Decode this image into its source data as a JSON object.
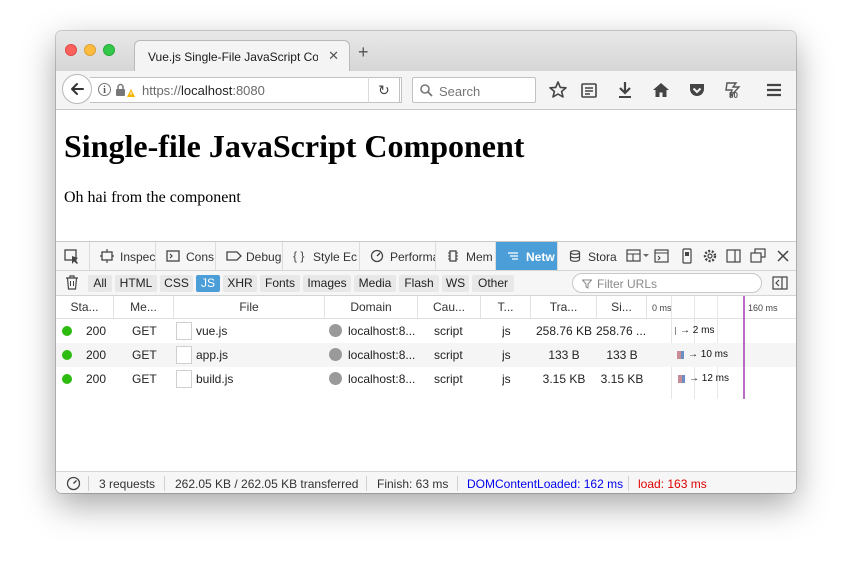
{
  "browser": {
    "tab_title": "Vue.js Single-File JavaScript Com",
    "url_scheme": "https://",
    "url_host": "localhost",
    "url_port": ":8080",
    "search_placeholder": "Search"
  },
  "page": {
    "heading": "Single-file JavaScript Component",
    "text": "Oh hai from the component"
  },
  "devtools": {
    "tabs": [
      "Inspec",
      "Cons",
      "Debug",
      "Style Ec",
      "Performa",
      "Mem",
      "Netw",
      "Stora"
    ],
    "active_tab": "Netw",
    "filters": [
      "All",
      "HTML",
      "CSS",
      "JS",
      "XHR",
      "Fonts",
      "Images",
      "Media",
      "Flash",
      "WS",
      "Other"
    ],
    "active_filter": "JS",
    "filter_placeholder": "Filter URLs",
    "columns": [
      "Sta...",
      "Me...",
      "File",
      "Domain",
      "Cau...",
      "T...",
      "Tra...",
      "Si..."
    ],
    "timeline_ticks": [
      "0 ms",
      "160 ms"
    ],
    "requests": [
      {
        "status": "200",
        "method": "GET",
        "file": "vue.js",
        "domain": "localhost:8...",
        "cause": "script",
        "type": "js",
        "transferred": "258.76 KB",
        "size": "258.76 ...",
        "timing": "→ 2 ms"
      },
      {
        "status": "200",
        "method": "GET",
        "file": "app.js",
        "domain": "localhost:8...",
        "cause": "script",
        "type": "js",
        "transferred": "133 B",
        "size": "133 B",
        "timing": "→ 10 ms"
      },
      {
        "status": "200",
        "method": "GET",
        "file": "build.js",
        "domain": "localhost:8...",
        "cause": "script",
        "type": "js",
        "transferred": "3.15 KB",
        "size": "3.15 KB",
        "timing": "→ 12 ms"
      }
    ],
    "summary": {
      "requests": "3 requests",
      "transferred": "262.05 KB / 262.05 KB transferred",
      "finish": "Finish: 63 ms",
      "dom_content_loaded": "DOMContentLoaded: 162 ms",
      "load": "load: 163 ms"
    },
    "colors": {
      "accent": "#4c9ed9",
      "status_ok": "#2cbb0f",
      "dcl": "#0000ee",
      "load": "#e00000",
      "dcl_marker": "#b76cc4"
    }
  }
}
